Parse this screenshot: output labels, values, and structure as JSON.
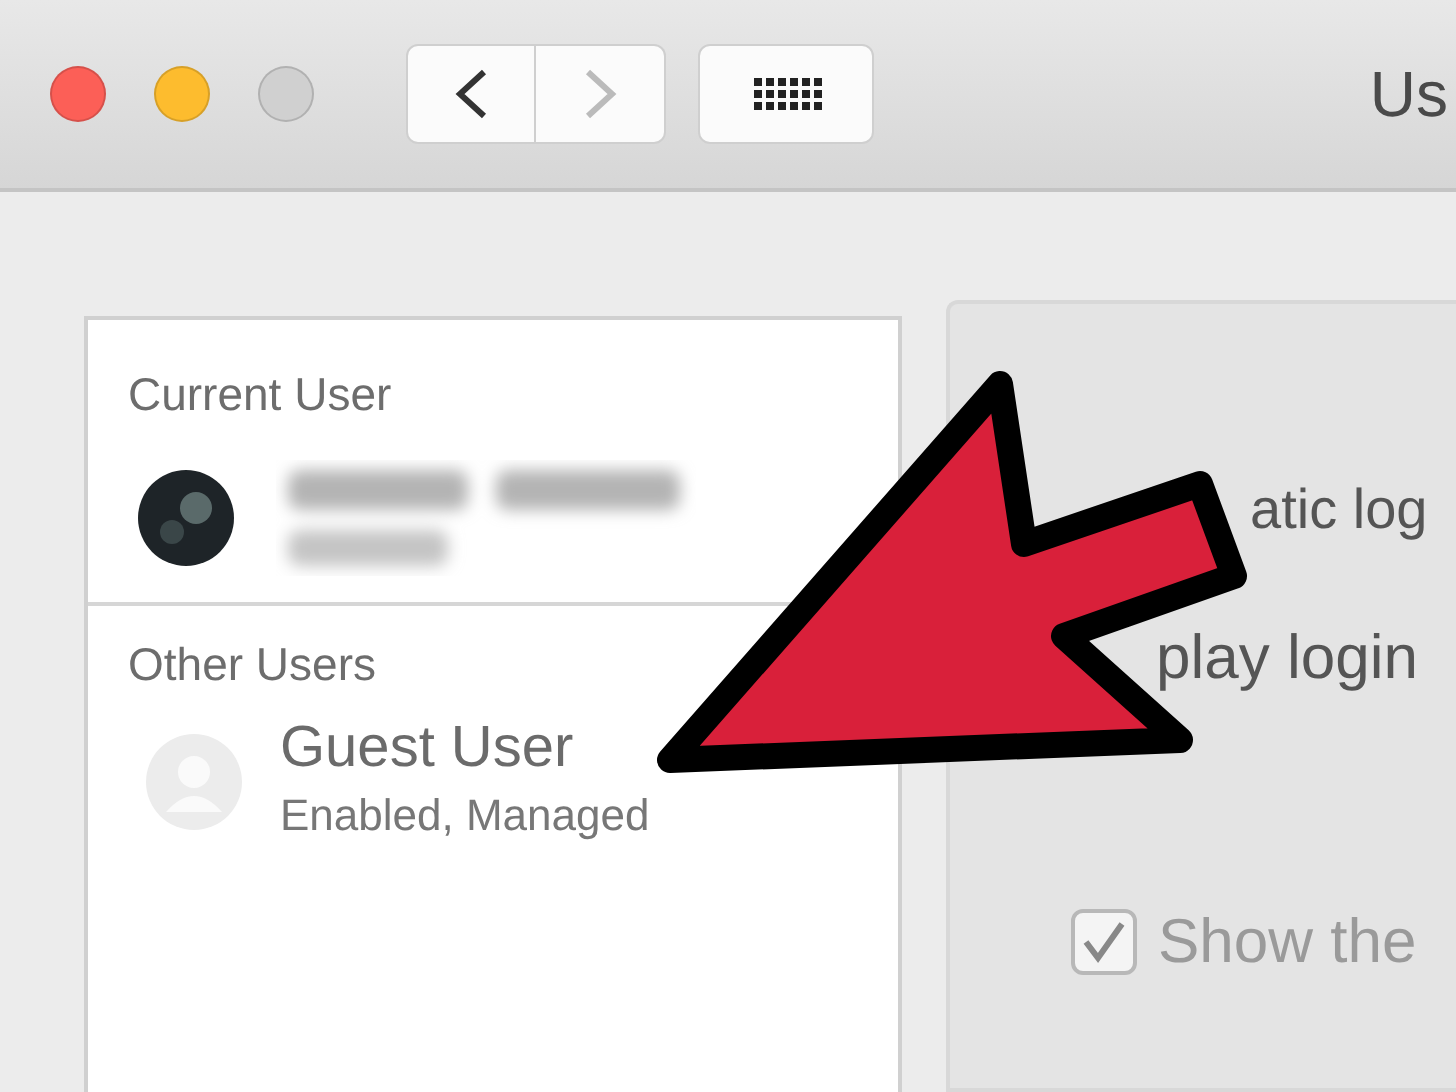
{
  "toolbar": {
    "title": "Us"
  },
  "users": {
    "current_heading": "Current User",
    "other_heading": "Other Users",
    "others": [
      {
        "name": "Guest User",
        "status": "Enabled, Managed"
      }
    ]
  },
  "options": [
    {
      "kind": "text",
      "label": "atic log"
    },
    {
      "kind": "text",
      "label": "play login"
    },
    {
      "kind": "checkbox",
      "label": "Show the",
      "checked": true
    }
  ]
}
